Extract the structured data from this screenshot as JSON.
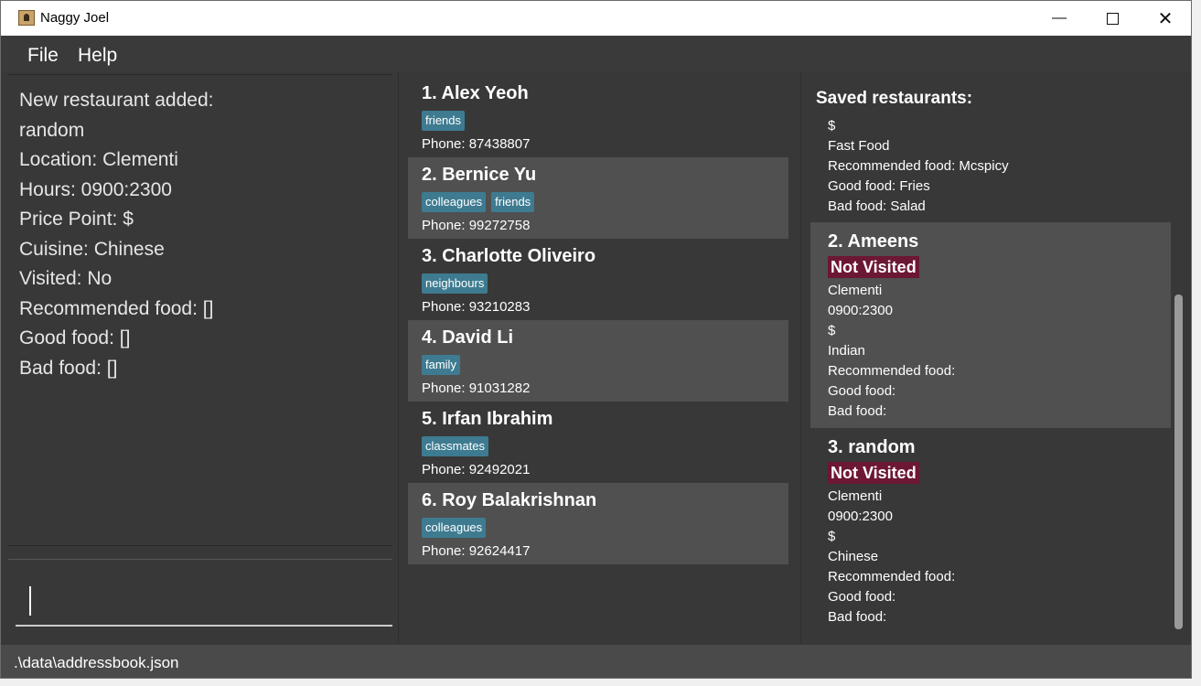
{
  "window": {
    "title": "Naggy Joel"
  },
  "menu": {
    "file": "File",
    "help": "Help"
  },
  "result": {
    "lines": [
      "New restaurant added:",
      "random",
      "Location: Clementi",
      "Hours: 0900:2300",
      "Price Point: $",
      "Cuisine: Chinese",
      "Visited: No",
      "Recommended food: []",
      "Good food: []",
      "Bad food: []"
    ]
  },
  "command": {
    "value": ""
  },
  "persons": [
    {
      "index": "1.",
      "name": "Alex Yeoh",
      "tags": [
        "friends"
      ],
      "phone": "Phone: 87438807"
    },
    {
      "index": "2.",
      "name": "Bernice Yu",
      "tags": [
        "colleagues",
        "friends"
      ],
      "phone": "Phone: 99272758"
    },
    {
      "index": "3.",
      "name": "Charlotte Oliveiro",
      "tags": [
        "neighbours"
      ],
      "phone": "Phone: 93210283"
    },
    {
      "index": "4.",
      "name": "David Li",
      "tags": [
        "family"
      ],
      "phone": "Phone: 91031282"
    },
    {
      "index": "5.",
      "name": "Irfan Ibrahim",
      "tags": [
        "classmates"
      ],
      "phone": "Phone: 92492021"
    },
    {
      "index": "6.",
      "name": "Roy Balakrishnan",
      "tags": [
        "colleagues"
      ],
      "phone": "Phone: 92624417"
    }
  ],
  "saved": {
    "header": "Saved restaurants:",
    "partial": {
      "lines": [
        "$",
        "Fast Food",
        "Recommended food: Mcspicy",
        "Good food: Fries",
        "Bad food: Salad"
      ]
    },
    "restaurants": [
      {
        "index": "2.",
        "name": "Ameens",
        "status": "Not Visited",
        "lines": [
          "Clementi",
          "0900:2300",
          "$",
          "Indian",
          "Recommended food:",
          "Good food:",
          "Bad food:"
        ]
      },
      {
        "index": "3.",
        "name": "random",
        "status": "Not Visited",
        "lines": [
          "Clementi",
          "0900:2300",
          "$",
          "Chinese",
          "Recommended food:",
          "Good food:",
          "Bad food:"
        ]
      }
    ]
  },
  "status": {
    "path": ".\\data\\addressbook.json"
  },
  "colors": {
    "tag": "#3e7b91",
    "not_visited": "#6c1733",
    "card_alt": "#505050",
    "background": "#383838"
  }
}
